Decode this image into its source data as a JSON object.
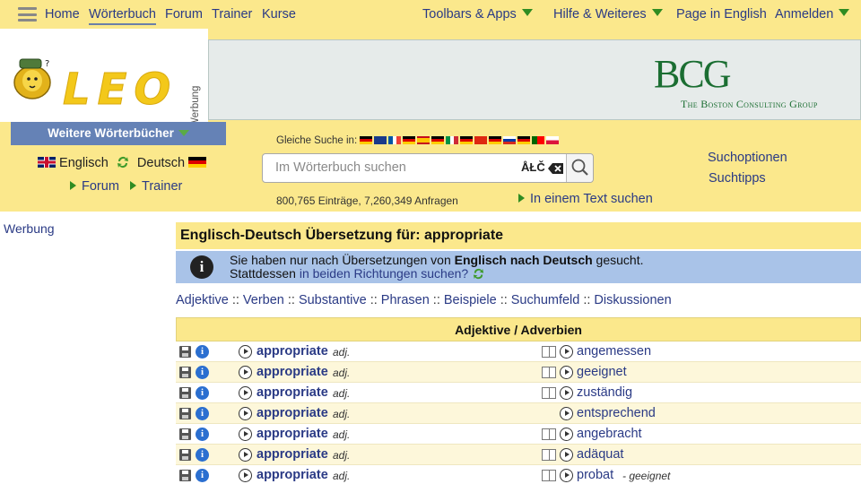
{
  "topnav": {
    "items": [
      "Home",
      "Wörterbuch",
      "Forum",
      "Trainer",
      "Kurse"
    ],
    "right": [
      "Toolbars & Apps",
      "Hilfe & Weiteres",
      "Page in English",
      "Anmelden"
    ]
  },
  "logo": {
    "text": "LEO",
    "werbung": "Werbung"
  },
  "banner": {
    "brand": "BCG",
    "subtitle": "The Boston Consulting Group"
  },
  "sidebar": {
    "weitere": "Weitere Wörterbücher",
    "lang_from": "Englisch",
    "lang_to": "Deutsch",
    "forum": "Forum",
    "trainer": "Trainer"
  },
  "search": {
    "gleiche": "Gleiche Suche in:",
    "placeholder": "Im Wörterbuch suchen",
    "special_chars": "ÅŁČ",
    "stats": "800,765 Einträge, 7,260,349 Anfragen",
    "text_search": "In einem Text suchen",
    "suchoptionen": "Suchoptionen",
    "suchtipps": "Suchtipps"
  },
  "werbung_left": "Werbung",
  "result": {
    "title": "Englisch-Deutsch Übersetzung für: appropriate",
    "info_line1_pre": "Sie haben nur nach Übersetzungen von ",
    "info_line1_bold": "Englisch nach Deutsch",
    "info_line1_post": " gesucht.",
    "info_line2_pre": "Stattdessen ",
    "info_line2_link": "in beiden Richtungen suchen?"
  },
  "categories": [
    "Adjektive",
    "Verben",
    "Substantive",
    "Phrasen",
    "Beispiele",
    "Suchumfeld",
    "Diskussionen"
  ],
  "table": {
    "header": "Adjektive / Adverbien",
    "rows": [
      {
        "en": "appropriate",
        "pos": "adj.",
        "de": "angemessen",
        "note": "",
        "book": true
      },
      {
        "en": "appropriate",
        "pos": "adj.",
        "de": "geeignet",
        "note": "",
        "book": true
      },
      {
        "en": "appropriate",
        "pos": "adj.",
        "de": "zuständig",
        "note": "",
        "book": true
      },
      {
        "en": "appropriate",
        "pos": "adj.",
        "de": "entsprechend",
        "note": "",
        "book": false
      },
      {
        "en": "appropriate",
        "pos": "adj.",
        "de": "angebracht",
        "note": "",
        "book": true
      },
      {
        "en": "appropriate",
        "pos": "adj.",
        "de": "adäquat",
        "note": "",
        "book": true
      },
      {
        "en": "appropriate",
        "pos": "adj.",
        "de": "probat",
        "note": "- geeignet",
        "book": true
      }
    ]
  },
  "colors": {
    "yellow": "#fbe88c",
    "blue_bar": "#a9c3e8",
    "link": "#2a3a85",
    "green": "#2f8c22"
  }
}
